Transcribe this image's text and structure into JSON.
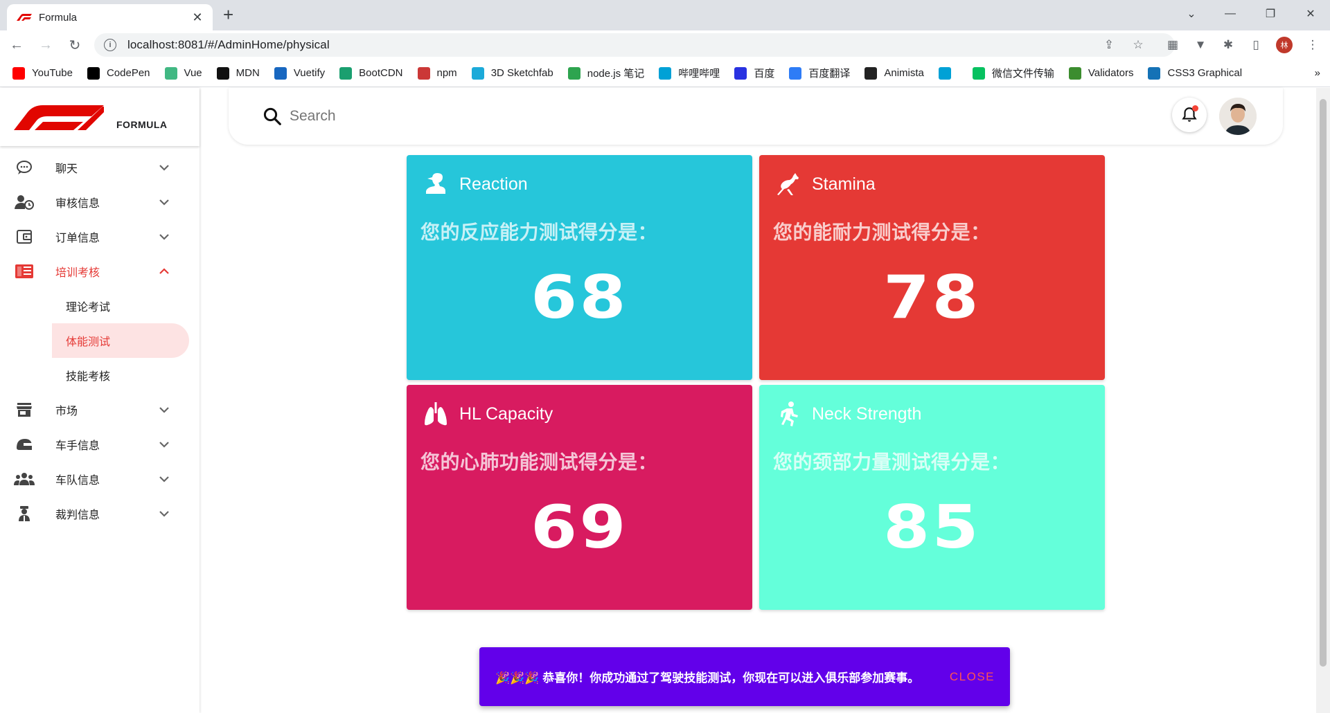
{
  "browser": {
    "tab_title": "Formula",
    "url": "localhost:8081/#/AdminHome/physical",
    "profile_initial": "林",
    "bookmarks": [
      {
        "label": "YouTube",
        "icon": "youtube-icon",
        "color": "#ff0000"
      },
      {
        "label": "CodePen",
        "icon": "codepen-icon",
        "color": "#000000"
      },
      {
        "label": "Vue",
        "icon": "vue-icon",
        "color": "#41b883"
      },
      {
        "label": "MDN",
        "icon": "mdn-icon",
        "color": "#111111"
      },
      {
        "label": "Vuetify",
        "icon": "vuetify-icon",
        "color": "#1867c0"
      },
      {
        "label": "BootCDN",
        "icon": "bootcdn-icon",
        "color": "#1a9f6f"
      },
      {
        "label": "npm",
        "icon": "npm-icon",
        "color": "#cb3837"
      },
      {
        "label": "3D Sketchfab",
        "icon": "sketchfab-icon",
        "color": "#1caad9"
      },
      {
        "label": "node.js 笔记",
        "icon": "node-icon",
        "color": "#2ea44f"
      },
      {
        "label": "哔哩哔哩",
        "icon": "bilibili-icon",
        "color": "#00a1d6"
      },
      {
        "label": "百度",
        "icon": "baidu-icon",
        "color": "#2932e1"
      },
      {
        "label": "百度翻译",
        "icon": "baidu-translate-icon",
        "color": "#2e7cf6"
      },
      {
        "label": "Animista",
        "icon": "animista-icon",
        "color": "#222222"
      },
      {
        "label": "",
        "icon": "bilibili-icon",
        "color": "#00a1d6"
      },
      {
        "label": "微信文件传输",
        "icon": "wechat-icon",
        "color": "#07c160"
      },
      {
        "label": "Validators",
        "icon": "validators-icon",
        "color": "#3c8d2f"
      },
      {
        "label": "CSS3 Graphical",
        "icon": "css3-icon",
        "color": "#1572b6"
      }
    ]
  },
  "brand": {
    "name": "FORMULA",
    "accent": "#e53935"
  },
  "sidebar": {
    "items": [
      {
        "label": "聊天",
        "icon": "chat-icon"
      },
      {
        "label": "审核信息",
        "icon": "user-clock-icon"
      },
      {
        "label": "订单信息",
        "icon": "wallet-icon"
      },
      {
        "label": "培训考核",
        "icon": "training-icon"
      },
      {
        "label": "市场",
        "icon": "store-icon"
      },
      {
        "label": "车手信息",
        "icon": "helmet-icon"
      },
      {
        "label": "车队信息",
        "icon": "team-icon"
      },
      {
        "label": "裁判信息",
        "icon": "referee-icon"
      }
    ],
    "sub_items": [
      {
        "label": "理论考试"
      },
      {
        "label": "体能测试"
      },
      {
        "label": "技能考核"
      }
    ]
  },
  "topbar": {
    "search_placeholder": "Search"
  },
  "cards": [
    {
      "title": "Reaction",
      "desc": "您的反应能力测试得分是：",
      "score": "68",
      "color": "#26c6da",
      "icon": "reaction-icon"
    },
    {
      "title": "Stamina",
      "desc": "您的能耐力测试得分是：",
      "score": "78",
      "color": "#e53935",
      "icon": "kangaroo-icon"
    },
    {
      "title": "HL Capacity",
      "desc": "您的心肺功能测试得分是：",
      "score": "69",
      "color": "#d81b60",
      "icon": "lungs-icon"
    },
    {
      "title": "Neck Strength",
      "desc": "您的颈部力量测试得分是：",
      "score": "85",
      "color": "#64ffda",
      "icon": "runner-icon"
    }
  ],
  "snackbar": {
    "message": "🎉🎉🎉 恭喜你！你成功通过了驾驶技能测试，你现在可以进入俱乐部参加赛事。",
    "close_label": "CLOSE",
    "color": "#6200ea"
  }
}
